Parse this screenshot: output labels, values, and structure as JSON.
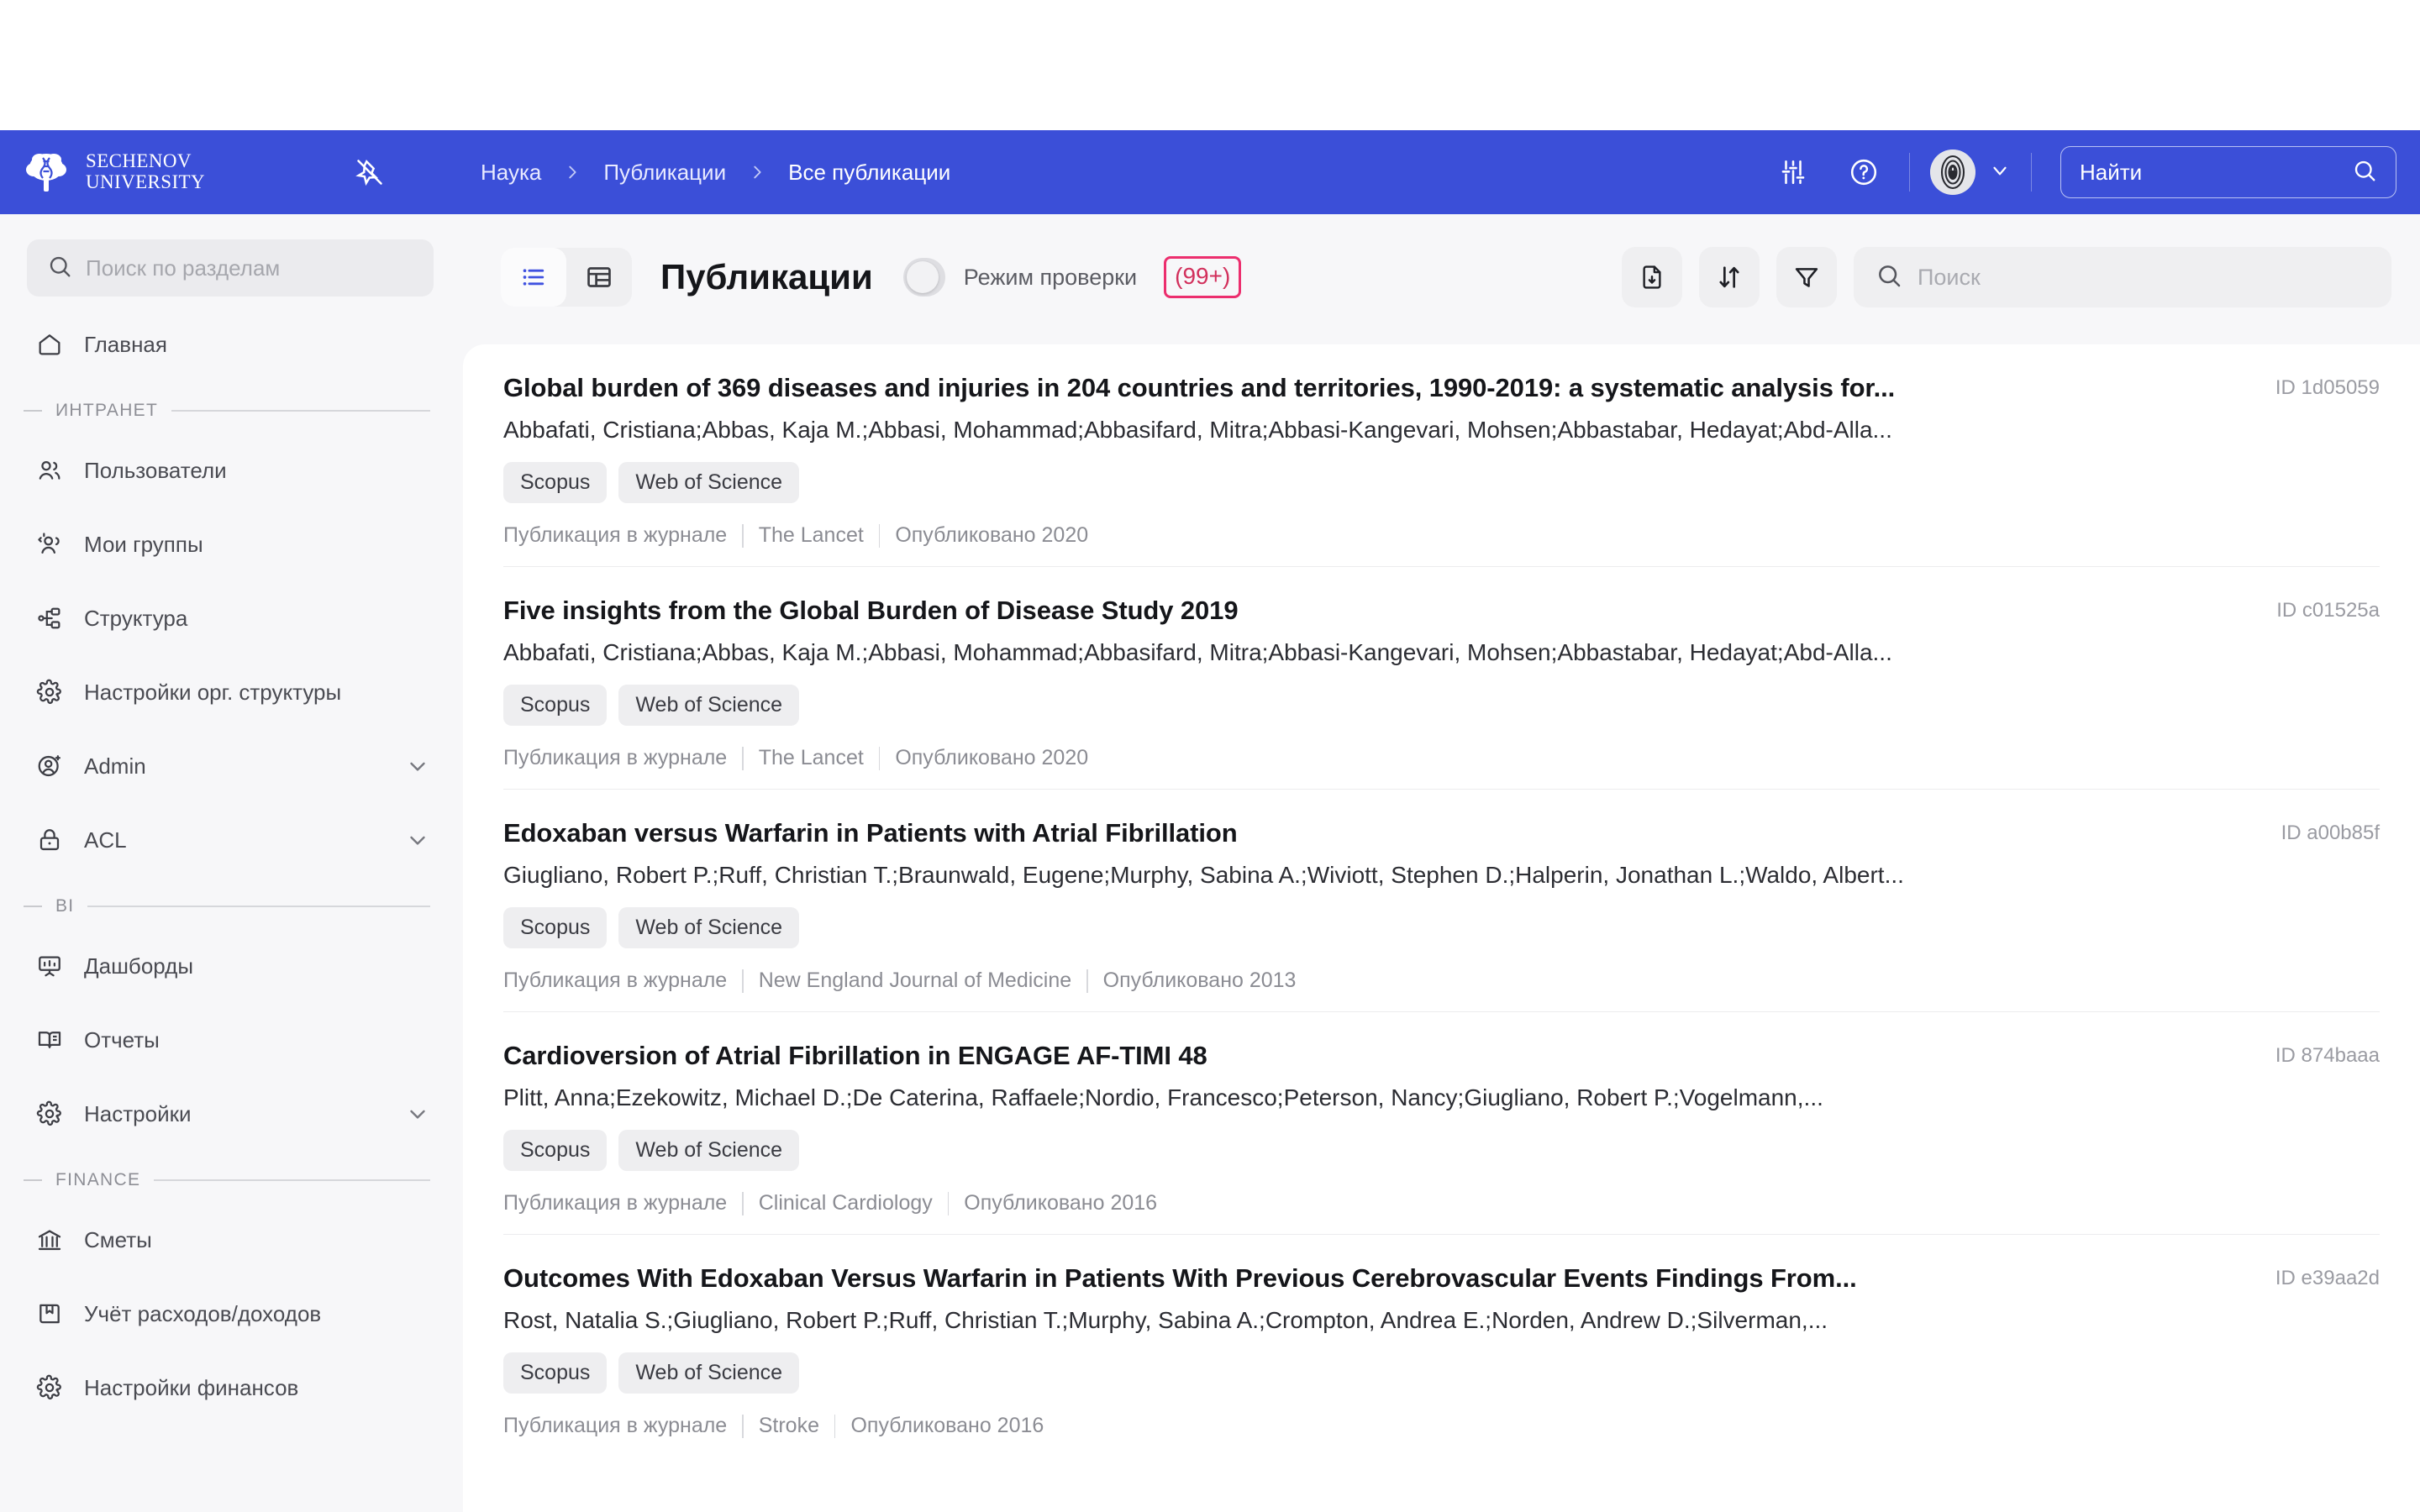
{
  "brand": {
    "line1": "SECHENOV",
    "line2": "UNIVERSITY",
    "logo_icon": "tree-logo-icon"
  },
  "header": {
    "pin_icon": "pin-off-icon",
    "breadcrumb": [
      "Наука",
      "Публикации",
      "Все публикации"
    ],
    "settings_icon": "sliders-icon",
    "help_icon": "question-circle-icon",
    "avatar_icon": "avatar",
    "chevron_icon": "chevron-down-icon",
    "search": {
      "placeholder": "Найти",
      "icon": "search-icon"
    }
  },
  "sidebar": {
    "search": {
      "placeholder": "Поиск по разделам",
      "icon": "search-icon"
    },
    "items": [
      {
        "type": "item",
        "label": "Главная",
        "icon": "home-icon",
        "chevron": false
      },
      {
        "type": "group",
        "label": "ИНТРАНЕТ"
      },
      {
        "type": "item",
        "label": "Пользователи",
        "icon": "users-icon",
        "chevron": false
      },
      {
        "type": "item",
        "label": "Мои группы",
        "icon": "user-group-icon",
        "chevron": false
      },
      {
        "type": "item",
        "label": "Структура",
        "icon": "sitemap-icon",
        "chevron": false
      },
      {
        "type": "item",
        "label": "Настройки орг. структуры",
        "icon": "gear-icon",
        "chevron": false
      },
      {
        "type": "item",
        "label": "Admin",
        "icon": "user-admin-icon",
        "chevron": true
      },
      {
        "type": "item",
        "label": "ACL",
        "icon": "lock-icon",
        "chevron": true
      },
      {
        "type": "group",
        "label": "BI"
      },
      {
        "type": "item",
        "label": "Дашборды",
        "icon": "dashboard-icon",
        "chevron": false
      },
      {
        "type": "item",
        "label": "Отчеты",
        "icon": "book-icon",
        "chevron": false
      },
      {
        "type": "item",
        "label": "Настройки",
        "icon": "gear-icon",
        "chevron": true
      },
      {
        "type": "group",
        "label": "FINANCE"
      },
      {
        "type": "item",
        "label": "Сметы",
        "icon": "bank-icon",
        "chevron": false
      },
      {
        "type": "item",
        "label": "Учёт расходов/доходов",
        "icon": "ledger-icon",
        "chevron": false
      },
      {
        "type": "item",
        "label": "Настройки финансов",
        "icon": "gear-icon",
        "chevron": false
      }
    ]
  },
  "toolbar": {
    "view_list_icon": "list-view-icon",
    "view_table_icon": "table-view-icon",
    "title": "Публикации",
    "toggle_label": "Режим проверки",
    "toggle_on": false,
    "count_badge": "(99+)",
    "count_badge_color": "#d2305c",
    "count_badge_border_color": "#ec2e6e",
    "export_icon": "file-download-icon",
    "sort_icon": "sort-arrows-icon",
    "filter_icon": "filter-icon",
    "search": {
      "placeholder": "Поиск",
      "icon": "search-icon"
    }
  },
  "publications": [
    {
      "title": "Global burden of 369 diseases and injuries in 204 countries and territories, 1990-2019: a systematic analysis for...",
      "authors": "Abbafati, Cristiana;Abbas, Kaja M.;Abbasi, Mohammad;Abbasifard, Mitra;Abbasi-Kangevari, Mohsen;Abbastabar, Hedayat;Abd-Alla...",
      "tags": [
        "Scopus",
        "Web of Science"
      ],
      "type": "Публикация в журнале",
      "journal": "The Lancet",
      "published": "Опубликовано 2020",
      "id": "ID 1d05059"
    },
    {
      "title": "Five insights from the Global Burden of Disease Study 2019",
      "authors": "Abbafati, Cristiana;Abbas, Kaja M.;Abbasi, Mohammad;Abbasifard, Mitra;Abbasi-Kangevari, Mohsen;Abbastabar, Hedayat;Abd-Alla...",
      "tags": [
        "Scopus",
        "Web of Science"
      ],
      "type": "Публикация в журнале",
      "journal": "The Lancet",
      "published": "Опубликовано 2020",
      "id": "ID c01525a"
    },
    {
      "title": "Edoxaban versus Warfarin in Patients with Atrial Fibrillation",
      "authors": "Giugliano, Robert P.;Ruff, Christian T.;Braunwald, Eugene;Murphy, Sabina A.;Wiviott, Stephen D.;Halperin, Jonathan L.;Waldo, Albert...",
      "tags": [
        "Scopus",
        "Web of Science"
      ],
      "type": "Публикация в журнале",
      "journal": "New England Journal of Medicine",
      "published": "Опубликовано 2013",
      "id": "ID a00b85f"
    },
    {
      "title": "Cardioversion of Atrial Fibrillation in ENGAGE AF-TIMI 48",
      "authors": "Plitt, Anna;Ezekowitz, Michael D.;De Caterina, Raffaele;Nordio, Francesco;Peterson, Nancy;Giugliano, Robert P.;Vogelmann,...",
      "tags": [
        "Scopus",
        "Web of Science"
      ],
      "type": "Публикация в журнале",
      "journal": "Clinical Cardiology",
      "published": "Опубликовано 2016",
      "id": "ID 874baaa"
    },
    {
      "title": "Outcomes With Edoxaban Versus Warfarin in Patients With Previous Cerebrovascular Events Findings From...",
      "authors": "Rost, Natalia S.;Giugliano, Robert P.;Ruff, Christian T.;Murphy, Sabina A.;Crompton, Andrea E.;Norden, Andrew D.;Silverman,...",
      "tags": [
        "Scopus",
        "Web of Science"
      ],
      "type": "Публикация в журнале",
      "journal": "Stroke",
      "published": "Опубликовано 2016",
      "id": "ID e39aa2d"
    }
  ],
  "colors": {
    "header_blue": "#3b4fd8",
    "page_bg": "#f7f7f9",
    "accent_pink": "#ec2e6e"
  }
}
